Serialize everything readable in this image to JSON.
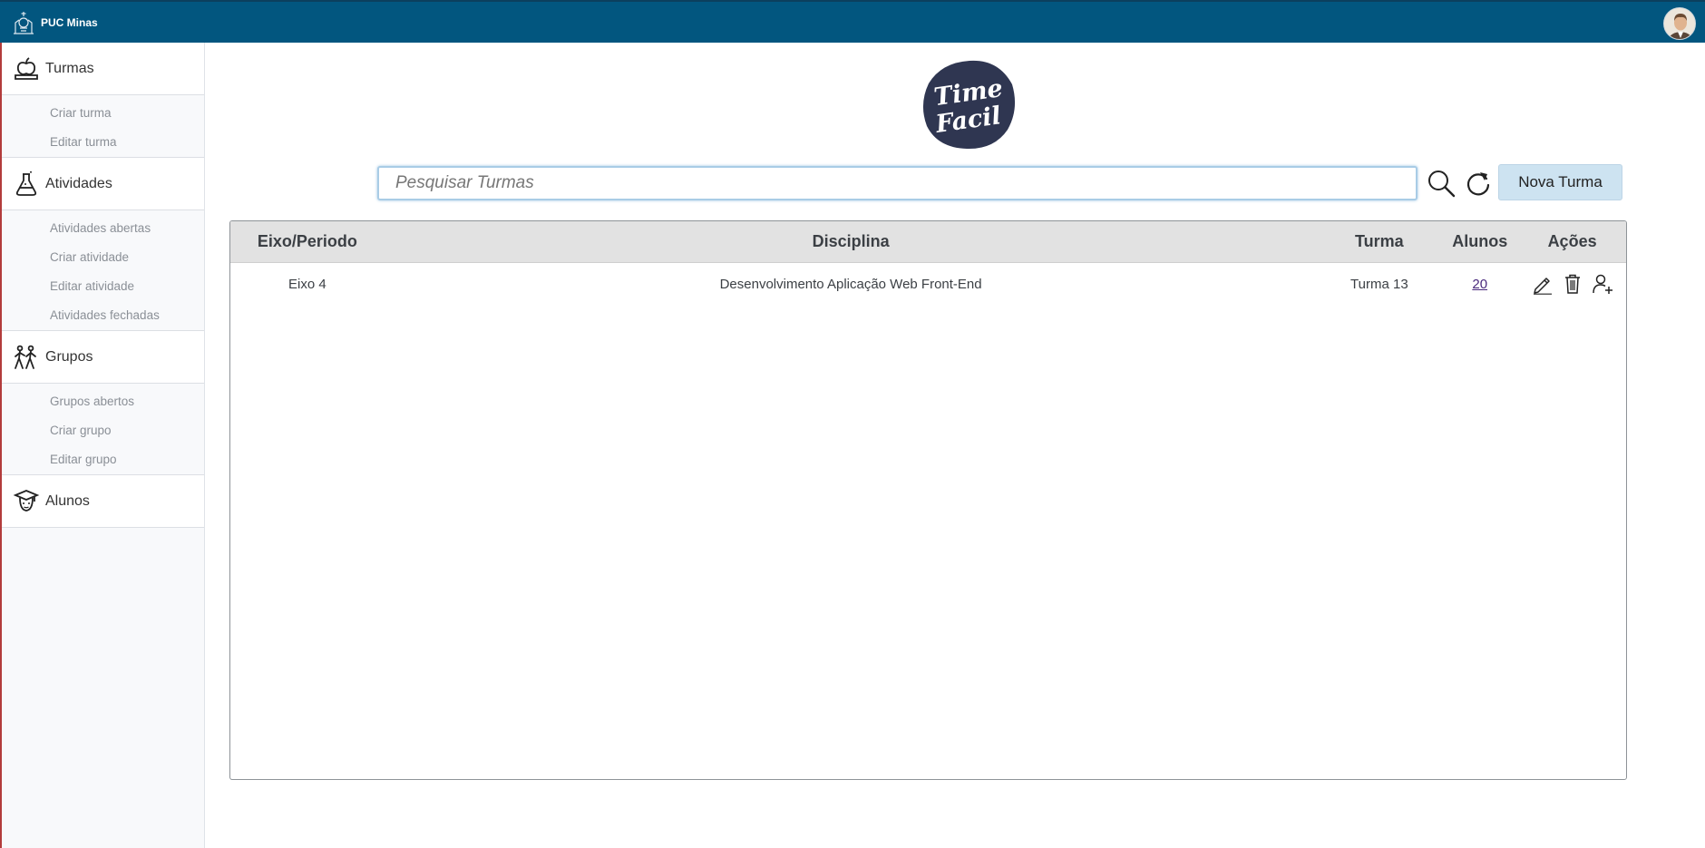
{
  "brand": {
    "name": "PUC Minas"
  },
  "sidebar": {
    "sections": [
      {
        "label": "Turmas",
        "icon": "apple-book-icon",
        "items": [
          "Criar turma",
          "Editar turma"
        ]
      },
      {
        "label": "Atividades",
        "icon": "flask-icon",
        "items": [
          "Atividades abertas",
          "Criar atividade",
          "Editar atividade",
          "Atividades fechadas"
        ]
      },
      {
        "label": "Grupos",
        "icon": "people-walking-icon",
        "items": [
          "Grupos abertos",
          "Criar grupo",
          "Editar grupo"
        ]
      },
      {
        "label": "Alunos",
        "icon": "graduate-icon",
        "items": []
      }
    ]
  },
  "main": {
    "logo_text_1": "Time",
    "logo_text_2": "Facil",
    "search": {
      "placeholder": "Pesquisar Turmas",
      "value": ""
    },
    "new_button": "Nova Turma"
  },
  "table": {
    "headers": [
      "Eixo/Periodo",
      "Disciplina",
      "Turma",
      "Alunos",
      "Ações"
    ],
    "rows": [
      {
        "eixo": "Eixo 4",
        "disciplina": "Desenvolvimento Aplicação Web Front-End",
        "turma": "Turma 13",
        "alunos": "20"
      }
    ]
  },
  "colors": {
    "topbar": "#02567f",
    "button": "#cde3f1",
    "logo_bg": "#2f3651"
  }
}
